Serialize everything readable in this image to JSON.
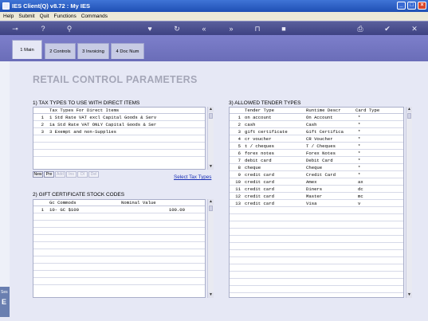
{
  "window": {
    "title": "IES Client(Q) v8.72 : My IES"
  },
  "menu": [
    "Help",
    "Submit",
    "Quit",
    "Functions",
    "Commands"
  ],
  "toolbar_icons": [
    "key-icon",
    "help-icon",
    "search-icon",
    "heart-icon",
    "refresh-icon",
    "rewind-icon",
    "fast-forward-icon",
    "lock-icon",
    "stop-icon",
    "print-icon",
    "check-icon",
    "close-icon"
  ],
  "tabs": [
    {
      "label": "1 Main",
      "active": true
    },
    {
      "label": "2 Controls",
      "active": false
    },
    {
      "label": "3 Invoicing",
      "active": false
    },
    {
      "label": "4 Doc Num",
      "active": false
    }
  ],
  "page_title": "RETAIL CONTROL PARAMETERS",
  "tax": {
    "title": "1) TAX TYPES TO USE WITH DIRECT ITEMS",
    "header": "Tax Types For Direct Items",
    "rows": [
      {
        "n": "1",
        "text": "1 Std Rate VAT excl Capital Goods & Serv"
      },
      {
        "n": "2",
        "text": "1a Std Rate VAT ONLY Capital Goods & Ser"
      },
      {
        "n": "3",
        "text": "3 Exempt and non-Supplies"
      }
    ],
    "nav": [
      "New",
      "Pre",
      "Add",
      "Ins",
      "Dl",
      "Del"
    ],
    "link": "Select Tax Types"
  },
  "gift": {
    "title": "2) GIFT CERTIFICATE STOCK CODES",
    "headers": [
      "Gc Commods",
      "Nominal Value"
    ],
    "rows": [
      {
        "n": "1",
        "code": "10- GC $100",
        "value": "100.00"
      }
    ]
  },
  "tender": {
    "title": "3) ALLOWED TENDER TYPES",
    "headers": [
      "Tender Type",
      "Runtime Descr",
      "Card Type"
    ],
    "rows": [
      {
        "n": "1",
        "type": "on account",
        "descr": "On Account",
        "card": "*"
      },
      {
        "n": "2",
        "type": "cash",
        "descr": "Cash",
        "card": "*"
      },
      {
        "n": "3",
        "type": "gift certificate",
        "descr": "Gift Certifica",
        "card": "*"
      },
      {
        "n": "4",
        "type": "cr voucher",
        "descr": "CR Voucher",
        "card": "*"
      },
      {
        "n": "5",
        "type": "t / cheques",
        "descr": "T / Cheques",
        "card": "*"
      },
      {
        "n": "6",
        "type": "forex notes",
        "descr": "Forex Notes",
        "card": "*"
      },
      {
        "n": "7",
        "type": "debit card",
        "descr": "Debit Card",
        "card": "*"
      },
      {
        "n": "8",
        "type": "cheque",
        "descr": "Cheque",
        "card": "*"
      },
      {
        "n": "9",
        "type": "credit card",
        "descr": "Credit Card",
        "card": "*"
      },
      {
        "n": "10",
        "type": "credit card",
        "descr": "Amex",
        "card": "ax"
      },
      {
        "n": "11",
        "type": "credit card",
        "descr": "Diners",
        "card": "dc"
      },
      {
        "n": "12",
        "type": "credit card",
        "descr": "Master",
        "card": "mc"
      },
      {
        "n": "13",
        "type": "credit card",
        "descr": "Visa",
        "card": "v"
      }
    ]
  },
  "side_tag": {
    "top": "Ses",
    "letter": "E"
  }
}
